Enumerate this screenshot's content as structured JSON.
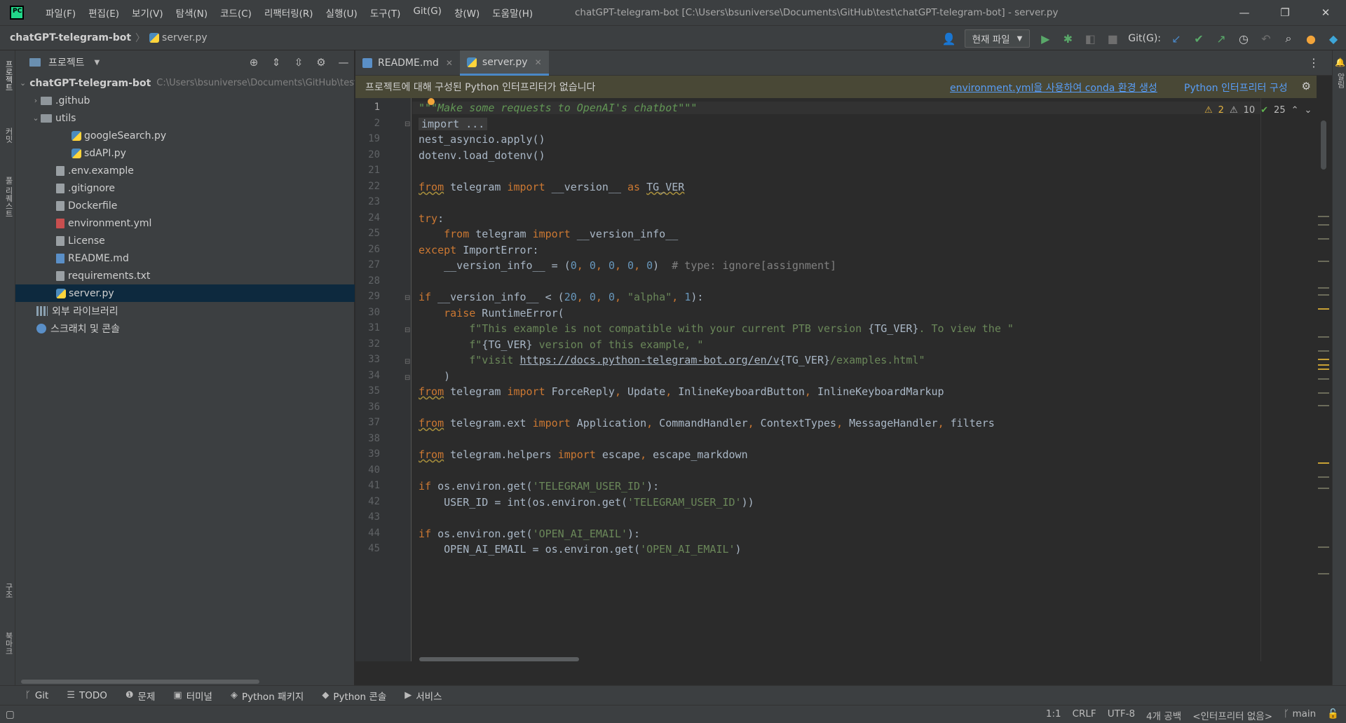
{
  "window": {
    "title": "chatGPT-telegram-bot [C:\\Users\\bsuniverse\\Documents\\GitHub\\test\\chatGPT-telegram-bot] - server.py",
    "menu": [
      "파일(F)",
      "편집(E)",
      "보기(V)",
      "탐색(N)",
      "코드(C)",
      "리팩터링(R)",
      "실행(U)",
      "도구(T)",
      "Git(G)",
      "창(W)",
      "도움말(H)"
    ],
    "controls": {
      "minimize": "—",
      "restore": "❐",
      "close": "✕"
    }
  },
  "navbar": {
    "project": "chatGPT-telegram-bot",
    "file": "server.py",
    "run_config": "현재 파일",
    "git_label": "Git(G):"
  },
  "left_stripe": {
    "project": "프로젝트",
    "commit": "커밋",
    "pull_requests": "풀 리퀘스트",
    "structure": "구조",
    "bookmarks": "북마크"
  },
  "right_stripe": {
    "notifications": "알림"
  },
  "project_panel": {
    "title": "프로젝트",
    "tree": [
      {
        "label": "chatGPT-telegram-bot",
        "hint": "C:\\Users\\bsuniverse\\Documents\\GitHub\\test\\chatGPT-telegram-bot",
        "type": "root"
      },
      {
        "label": ".github",
        "type": "folder"
      },
      {
        "label": "utils",
        "type": "folder"
      },
      {
        "label": "googleSearch.py",
        "type": "py"
      },
      {
        "label": "sdAPI.py",
        "type": "py"
      },
      {
        "label": ".env.example",
        "type": "file"
      },
      {
        "label": ".gitignore",
        "type": "file"
      },
      {
        "label": "Dockerfile",
        "type": "file"
      },
      {
        "label": "environment.yml",
        "type": "yml"
      },
      {
        "label": "License",
        "type": "file"
      },
      {
        "label": "README.md",
        "type": "md"
      },
      {
        "label": "requirements.txt",
        "type": "file"
      },
      {
        "label": "server.py",
        "type": "py"
      },
      {
        "label": "외부 라이브러리",
        "type": "lib"
      },
      {
        "label": "스크래치 및 콘솔",
        "type": "scratch"
      }
    ]
  },
  "tabs": [
    {
      "label": "README.md"
    },
    {
      "label": "server.py"
    }
  ],
  "banner": {
    "message": "프로젝트에 대해 구성된 Python 인터프리터가 없습니다",
    "link_conda": "environment.yml을 사용하여 conda 환경 생성",
    "link_configure": "Python 인터프리터 구성"
  },
  "inspections": {
    "warnings": "2",
    "weak_warnings": "10",
    "ok": "25"
  },
  "editor": {
    "line_numbers": [
      "1",
      "2",
      "19",
      "20",
      "21",
      "22",
      "23",
      "24",
      "25",
      "26",
      "27",
      "28",
      "29",
      "30",
      "31",
      "32",
      "33",
      "34",
      "35",
      "36",
      "37",
      "38",
      "39",
      "40",
      "41",
      "42",
      "43",
      "44",
      "45"
    ],
    "code": {
      "l1": "\"\"\"Make some requests to OpenAI's chatbot\"\"\"",
      "l2": "import ...",
      "l19": "nest_asyncio.apply()",
      "l20": "dotenv.load_dotenv()",
      "l22_from": "from",
      "l22_a": " telegram ",
      "l22_import": "import",
      "l22_b": " __version__ ",
      "l22_as": "as",
      "l22_c": " ",
      "l22_tg": "TG_VER",
      "l24_try": "try",
      "l24_colon": ":",
      "l25_from": "from",
      "l25_a": " telegram ",
      "l25_import": "import",
      "l25_b": " __version_info__",
      "l26_except": "except",
      "l26_a": " ImportError:",
      "l27_a": "    __version_info__ = (",
      "l27_n": "0",
      "l27_c": ", ",
      "l27_end": ")  ",
      "l27_cmt": "# type: ignore[assignment]",
      "l29_if": "if",
      "l29_a": " __version_info__ < (",
      "l29_n20": "20",
      "l29_n0": "0",
      "l29_alpha": "\"alpha\"",
      "l29_n1": "1",
      "l29_end": "):",
      "l30_raise": "raise",
      "l30_a": " RuntimeError(",
      "l31_f": "f",
      "l31_s1": "\"This example is not compatible with your current PTB version ",
      "l31_v": "{TG_VER}",
      "l31_s2": ". To view the \"",
      "l32_s1": "\"",
      "l32_s2": " version of this example, \"",
      "l33_s1": "\"visit ",
      "l33_url": "https://docs.python-telegram-bot.org/en/v",
      "l33_s2": "/examples.html\"",
      "l34": "    )",
      "l35_a": " telegram ",
      "l35_b": " ForceReply",
      "l35_c": " Update",
      "l35_d": " InlineKeyboardButton",
      "l35_e": " InlineKeyboardMarkup",
      "l37_a": " telegram.ext ",
      "l37_b": " Application",
      "l37_c": " CommandHandler",
      "l37_d": " ContextTypes",
      "l37_e": " MessageHandler",
      "l37_f": " filters",
      "l39_a": " telegram.helpers ",
      "l39_b": " escape",
      "l39_c": " escape_markdown",
      "comma": ",",
      "l41_a": " os.environ.get(",
      "l41_s": "'TELEGRAM_USER_ID'",
      "l41_end": "):",
      "l42_a": "    USER_ID = int(os.environ.get(",
      "l42_end": "))",
      "l44_s": "'OPEN_AI_EMAIL'",
      "l45_a": "    OPEN_AI_EMAIL = os.environ.get(",
      "l45_end": ")"
    }
  },
  "bottom_tools": [
    "Git",
    "TODO",
    "문제",
    "터미널",
    "Python 패키지",
    "Python 콘솔",
    "서비스"
  ],
  "status": {
    "position": "1:1",
    "line_sep": "CRLF",
    "encoding": "UTF-8",
    "indent": "4개 공백",
    "interpreter": "<인터프리터 없음>",
    "branch": "main"
  }
}
